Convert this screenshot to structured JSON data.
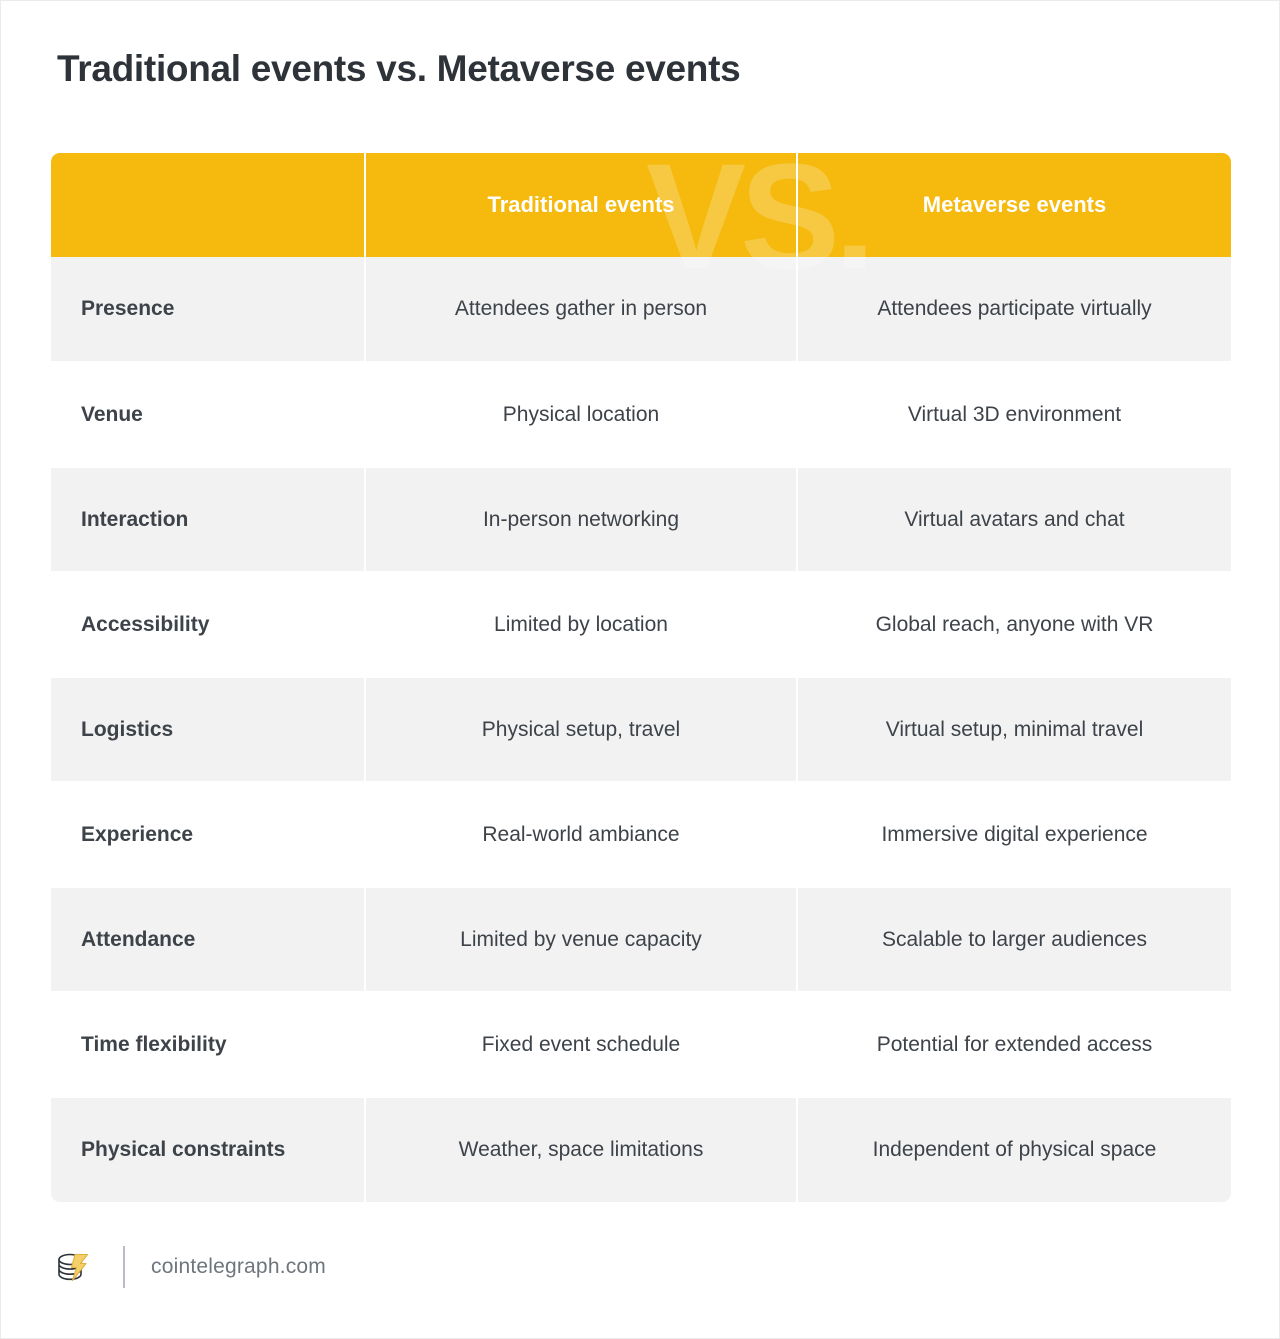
{
  "page": {
    "title": "Traditional events vs. Metaverse events",
    "watermark": "VS.",
    "accent_color": "#F5BA0D",
    "stripe_color": "#F2F2F2",
    "text_color": "#2D3338"
  },
  "table": {
    "columns": [
      "",
      "Traditional events",
      "Metaverse events"
    ],
    "rows": [
      {
        "label": "Presence",
        "traditional": "Attendees gather in person",
        "metaverse": "Attendees participate virtually"
      },
      {
        "label": "Venue",
        "traditional": "Physical location",
        "metaverse": "Virtual 3D environment"
      },
      {
        "label": "Interaction",
        "traditional": "In-person networking",
        "metaverse": "Virtual avatars and chat"
      },
      {
        "label": "Accessibility",
        "traditional": "Limited by location",
        "metaverse": "Global reach, anyone with VR"
      },
      {
        "label": "Logistics",
        "traditional": "Physical setup, travel",
        "metaverse": "Virtual setup, minimal travel"
      },
      {
        "label": "Experience",
        "traditional": "Real-world ambiance",
        "metaverse": "Immersive digital experience"
      },
      {
        "label": "Attendance",
        "traditional": "Limited by venue capacity",
        "metaverse": "Scalable to larger audiences"
      },
      {
        "label": "Time flexibility",
        "traditional": "Fixed event schedule",
        "metaverse": "Potential for extended access"
      },
      {
        "label": "Physical constraints",
        "traditional": "Weather, space limitations",
        "metaverse": "Independent of physical space"
      }
    ]
  },
  "footer": {
    "logo_icon": "cointelegraph-coin-stack-bolt-icon",
    "link_text": "cointelegraph.com"
  }
}
